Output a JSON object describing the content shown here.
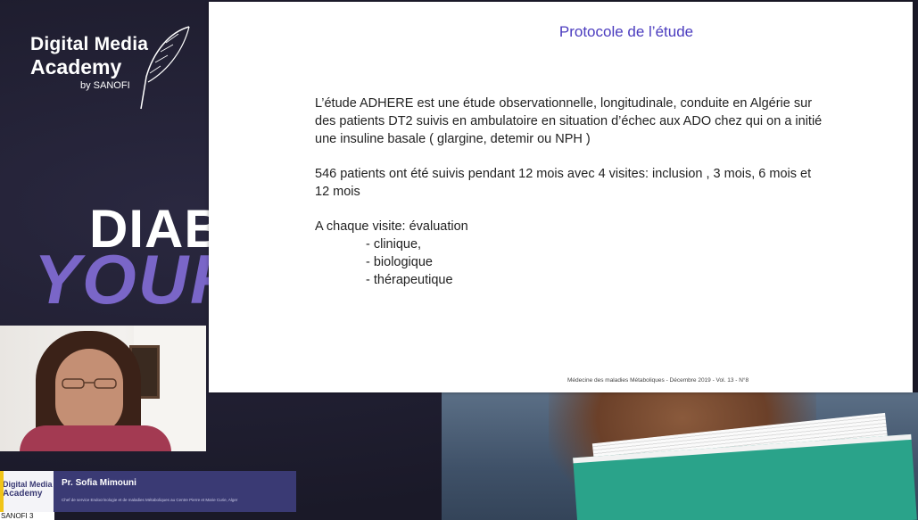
{
  "logo": {
    "line1": "Digital Media",
    "line2": "Academy",
    "line3": "by SANOFI",
    "icon": "feather-icon"
  },
  "background_text": {
    "line1": "DIAB",
    "line2": "YOUR"
  },
  "slide": {
    "title": "Protocole de l’étude",
    "paragraph1": "L’étude ADHERE est une étude observationnelle, longitudinale, conduite en Algérie sur des patients DT2 suivis en ambulatoire en situation d’échec aux ADO chez qui on a initié une insuline basale ( glargine, detemir ou NPH )",
    "paragraph2": "546 patients ont été suivis pendant 12 mois avec 4 visites: inclusion , 3 mois, 6 mois et 12 mois",
    "paragraph3": "A chaque visite: évaluation",
    "items": [
      "- clinique,",
      "- biologique",
      "- thérapeutique"
    ],
    "citation": "Médecine des maladies Métaboliques - Décembre 2019 - Vol. 13 - N°8"
  },
  "lower_third": {
    "mini_logo_line1": "Digital Media",
    "mini_logo_line2": "Academy",
    "speaker_name": "Pr. Sofia Mimouni",
    "speaker_desc": "Chef de service Endocrinologie et de maladies Métaboliques au Centre Pierre et Marie Curie, Alger"
  },
  "feed_label": "SANOFI 3",
  "colors": {
    "slide_title": "#4b3cbf",
    "lower_third_bg": "#3a3a74",
    "background": "#1c1b2c",
    "accent_purple": "#7a66c8"
  }
}
